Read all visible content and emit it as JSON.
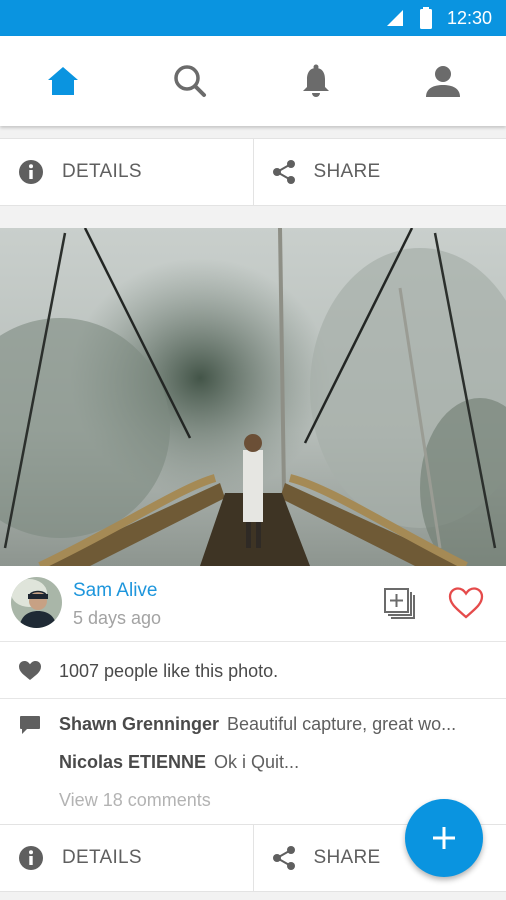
{
  "status_bar": {
    "time": "12:30"
  },
  "nav": {
    "items": [
      {
        "name": "home",
        "icon": "home-icon",
        "active": true
      },
      {
        "name": "search",
        "icon": "search-icon",
        "active": false
      },
      {
        "name": "notifications",
        "icon": "bell-icon",
        "active": false
      },
      {
        "name": "profile",
        "icon": "person-icon",
        "active": false
      }
    ],
    "active_color": "#0a94e0",
    "inactive_color": "#6b6b6b"
  },
  "top_actions": {
    "details_label": "DETAILS",
    "share_label": "SHARE"
  },
  "post": {
    "author": "Sam Alive",
    "time_ago": "5 days ago",
    "likes_text": "1007 people like this photo.",
    "comments": [
      {
        "user": "Shawn Grenninger",
        "text": "Beautiful capture, great wo..."
      },
      {
        "user": "Nicolas ETIENNE",
        "text": "Ok i Quit..."
      }
    ],
    "view_comments": "View 18 comments"
  },
  "bottom_actions": {
    "details_label": "DETAILS",
    "share_label": "SHARE"
  },
  "colors": {
    "accent": "#0a94e0",
    "heart": "#e54b4b",
    "link": "#1e96dc"
  }
}
